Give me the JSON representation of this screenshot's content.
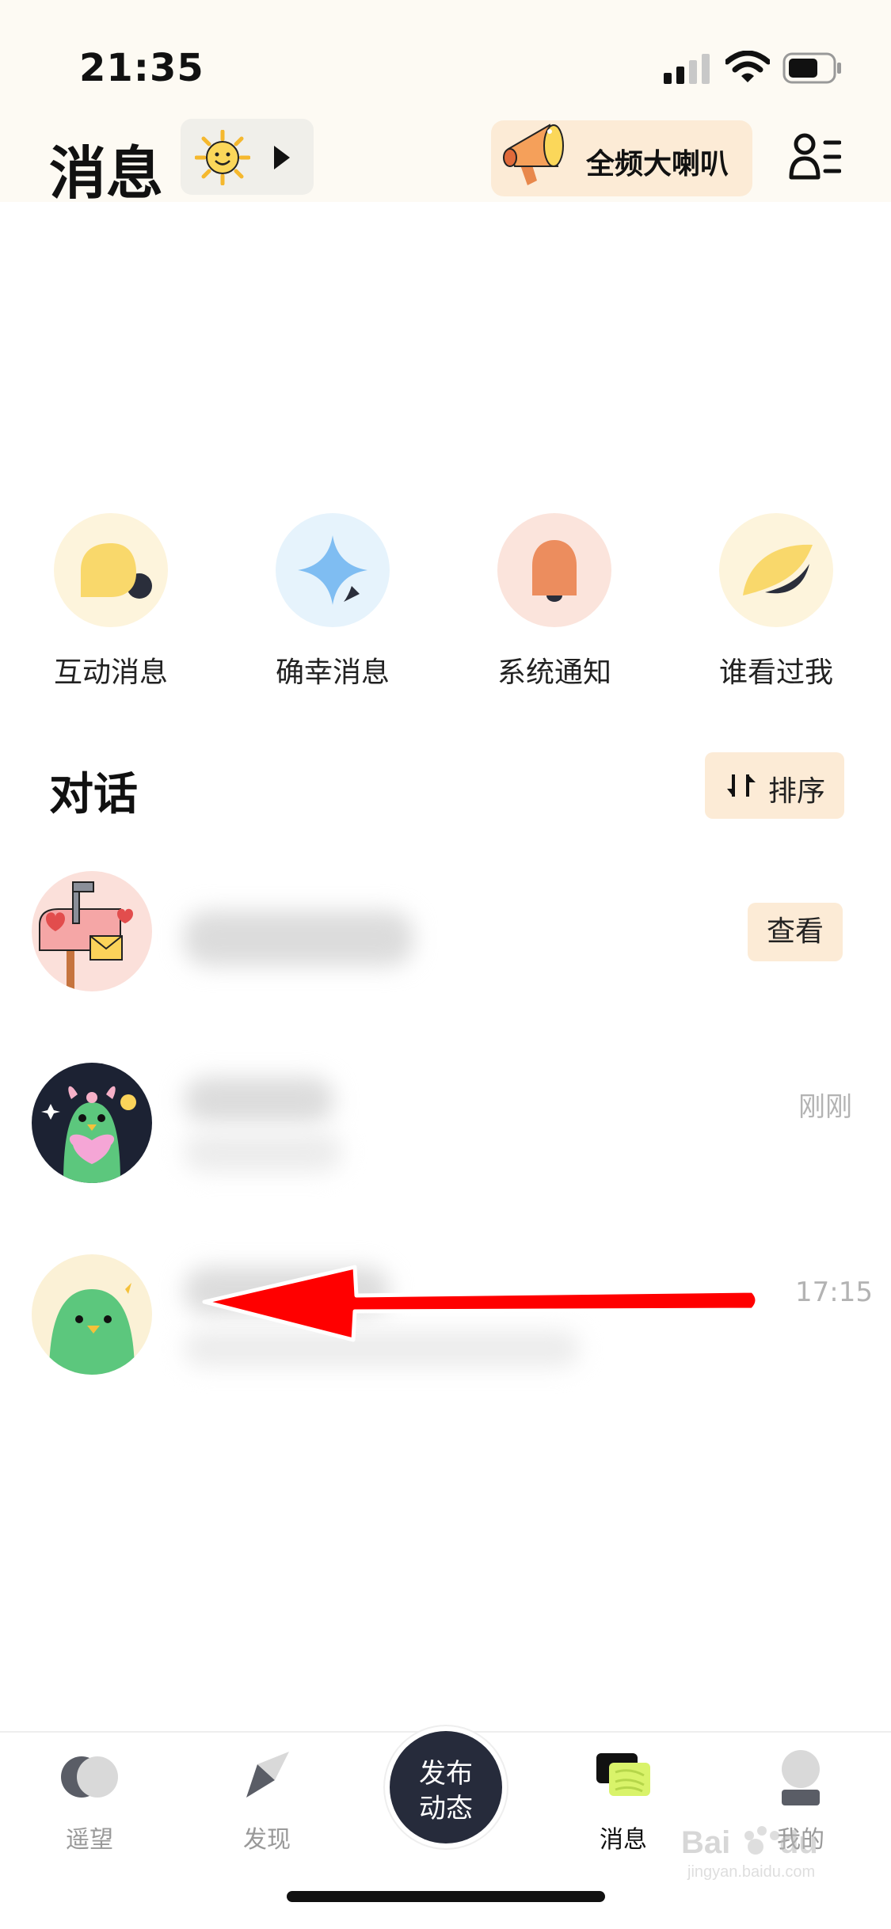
{
  "status_bar": {
    "time": "21:35"
  },
  "header": {
    "title": "消息",
    "broadcast_label": "全频大喇叭"
  },
  "shortcuts": [
    {
      "label": "互动消息",
      "icon": "speech-bubble-icon",
      "bg": "#fdf4dc"
    },
    {
      "label": "确幸消息",
      "icon": "sparkle-icon",
      "bg": "#e6f3fc"
    },
    {
      "label": "系统通知",
      "icon": "bell-icon",
      "bg": "#fbe4dc"
    },
    {
      "label": "谁看过我",
      "icon": "leaf-icon",
      "bg": "#fdf4dc"
    }
  ],
  "conversations": {
    "title": "对话",
    "sort_label": "排序",
    "items": [
      {
        "avatar": "mailbox-avatar",
        "action_label": "查看"
      },
      {
        "avatar": "green-bird-bow-avatar",
        "time": "刚刚"
      },
      {
        "avatar": "green-bird-avatar",
        "time": "17:15"
      }
    ]
  },
  "tabbar": {
    "tabs": [
      {
        "label": "遥望",
        "icon": "moons-icon"
      },
      {
        "label": "发现",
        "icon": "compass-icon"
      },
      {
        "label": "消息",
        "icon": "message-icon",
        "active": true
      },
      {
        "label": "我的",
        "icon": "profile-icon"
      }
    ],
    "publish": {
      "line1": "发布",
      "line2": "动态"
    }
  },
  "colors": {
    "accent_bg": "#fcebd6",
    "publish_button": "#262b3b",
    "annotation_arrow": "#ff0000"
  }
}
